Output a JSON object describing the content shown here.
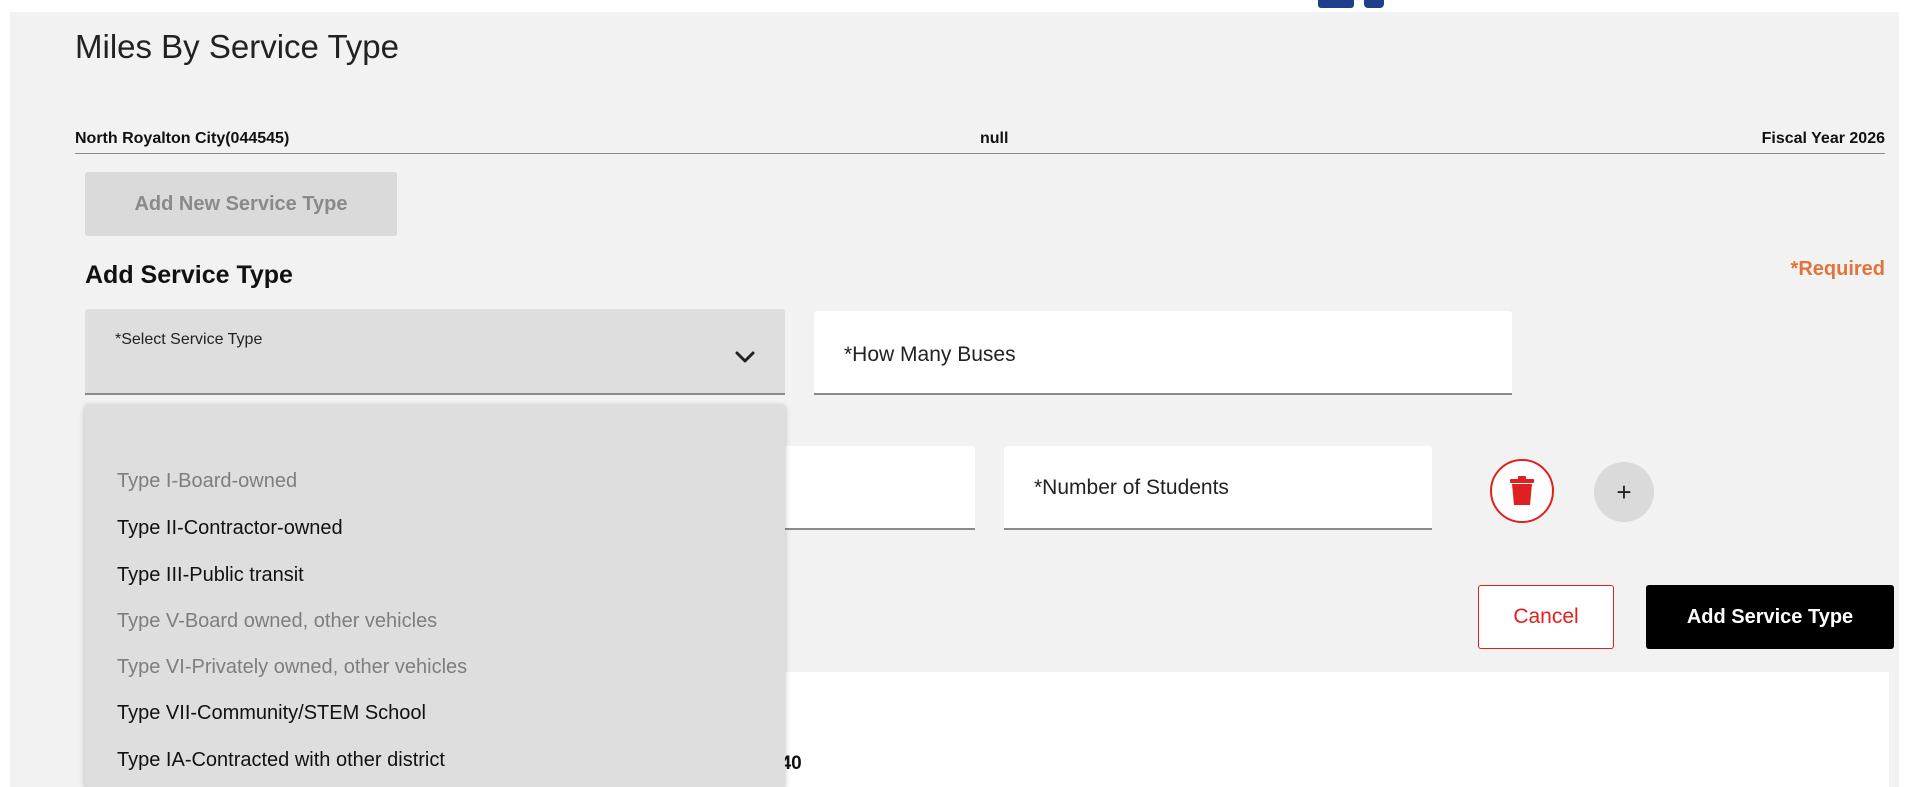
{
  "page": {
    "title": "Miles By Service Type"
  },
  "info_bar": {
    "district": "North Royalton City(044545)",
    "middle": "null",
    "fiscal_year": "Fiscal Year 2026"
  },
  "buttons": {
    "add_new_service_type": "Add New Service Type",
    "cancel": "Cancel",
    "add_service_type": "Add Service Type",
    "add_row": "+"
  },
  "form": {
    "title": "Add Service Type",
    "required_note": "*Required",
    "service_type_select": {
      "label": "*Select Service Type",
      "value": "",
      "expanded": true
    },
    "buses_field": {
      "placeholder": "*How Many Buses"
    },
    "students_field": {
      "placeholder": "*Number of Students"
    }
  },
  "dropdown": {
    "options": [
      {
        "label": "Type I-Board-owned",
        "disabled": true
      },
      {
        "label": "Type II-Contractor-owned",
        "disabled": false
      },
      {
        "label": "Type III-Public transit",
        "disabled": false
      },
      {
        "label": "Type V-Board owned, other vehicles",
        "disabled": true
      },
      {
        "label": "Type VI-Privately owned, other vehicles",
        "disabled": true
      },
      {
        "label": "Type VII-Community/STEM School",
        "disabled": false
      },
      {
        "label": "Type IA-Contracted with other district",
        "disabled": false
      }
    ]
  },
  "summary": {
    "partial_label": ":",
    "value": "40"
  },
  "icons": {
    "chevron": "chevron-down-icon",
    "delete": "trash-icon",
    "brand": "brand-logo-icon"
  },
  "colors": {
    "danger": "#e02020",
    "required": "#e0743a",
    "brand": "#1f3e8e",
    "primary_button": "#000000"
  }
}
